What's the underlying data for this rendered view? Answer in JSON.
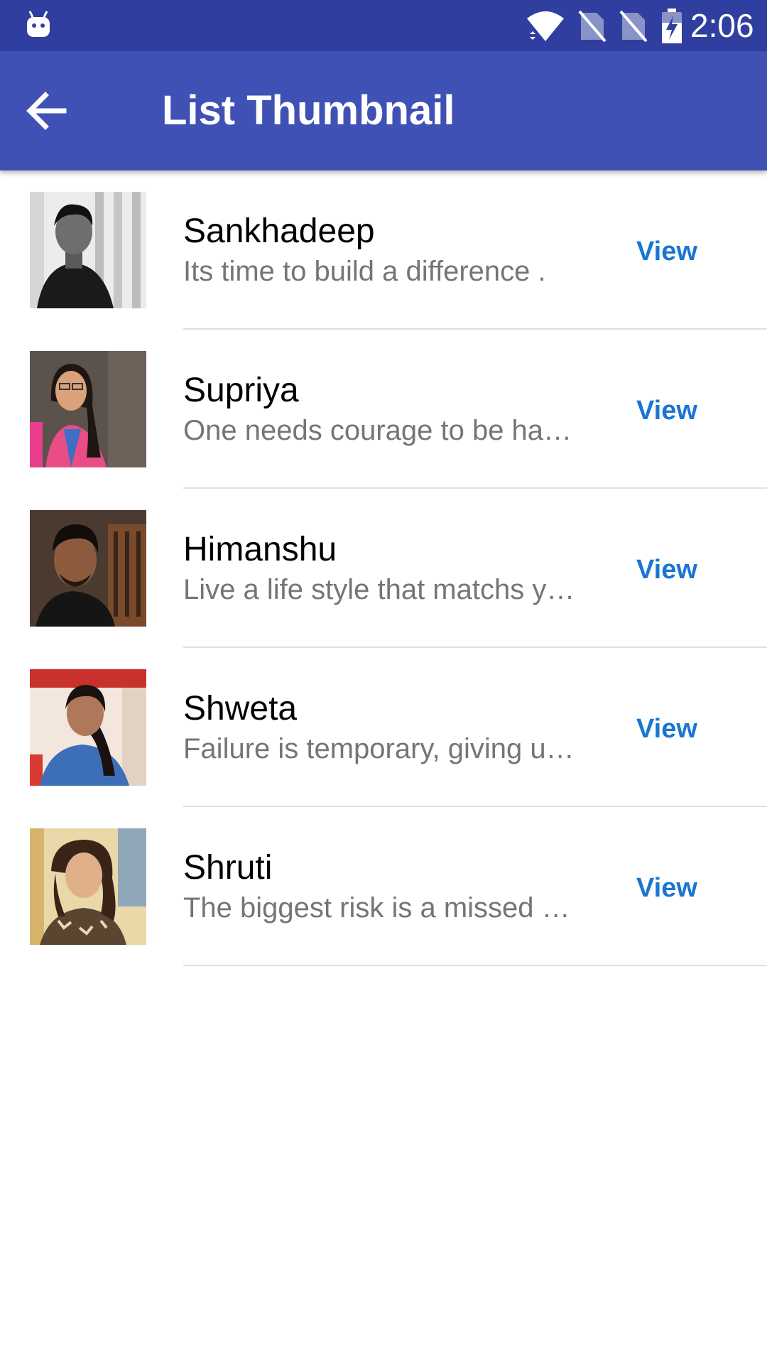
{
  "status_bar": {
    "time": "2:06",
    "icons": [
      "android-notification-icon",
      "wifi-icon",
      "no-sim-icon",
      "no-sim-icon",
      "battery-charging-icon"
    ]
  },
  "app_bar": {
    "title": "List Thumbnail",
    "back_icon": "arrow-back-icon"
  },
  "colors": {
    "status_bar": "#303f9f",
    "app_bar": "#3f51b5",
    "accent": "#1976d2",
    "secondary_text": "#757575"
  },
  "items": [
    {
      "name": "Sankhadeep",
      "description": "Its time to build a difference .",
      "action": "View"
    },
    {
      "name": "Supriya",
      "description": "One needs courage to be happy .",
      "action": "View"
    },
    {
      "name": "Himanshu",
      "description": "Live a life style that matchs your vision",
      "action": "View"
    },
    {
      "name": "Shweta",
      "description": "Failure is temporary, giving up makes it permanent",
      "action": "View"
    },
    {
      "name": "Shruti",
      "description": "The biggest risk is a missed opportunity",
      "action": "View"
    }
  ]
}
